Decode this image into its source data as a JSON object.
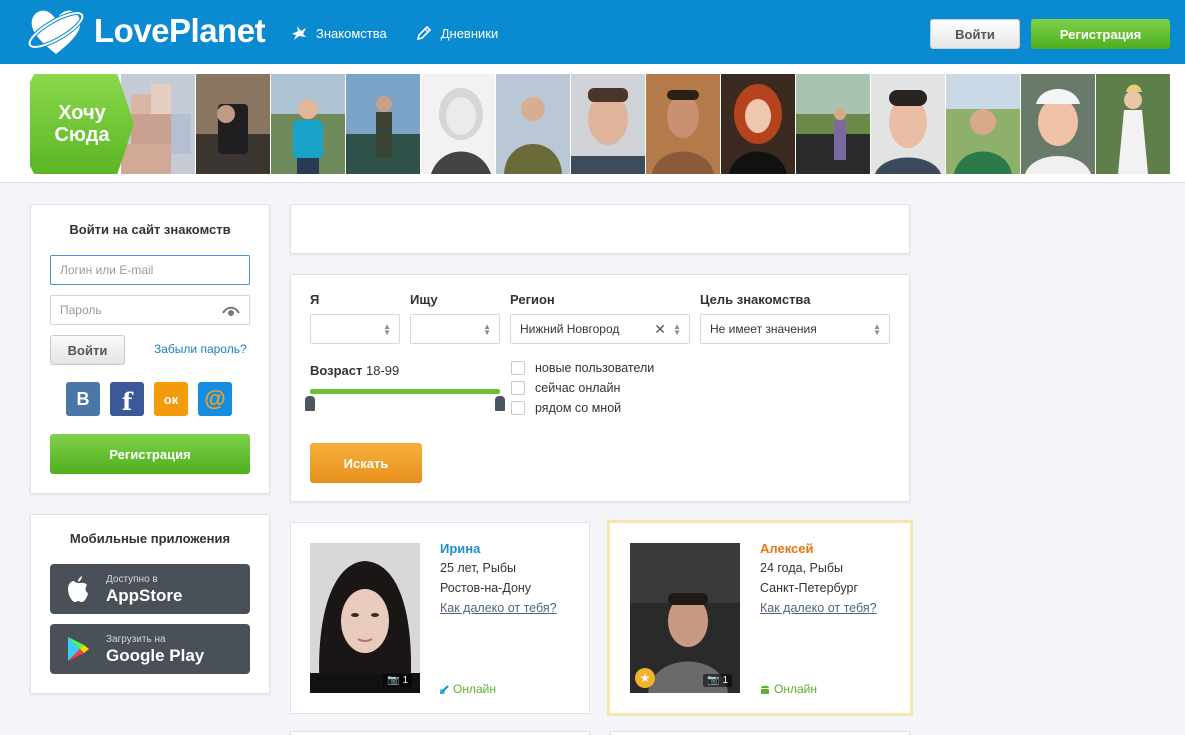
{
  "header": {
    "logo_text": "LovePlanet",
    "nav": [
      {
        "label": "Знакомства",
        "icon": "bird-icon"
      },
      {
        "label": "Дневники",
        "icon": "pencil-icon"
      }
    ],
    "login_label": "Войти",
    "register_label": "Регистрация"
  },
  "strip": {
    "cta_label": "Хочу Сюда"
  },
  "login": {
    "title": "Войти на сайт знакомств",
    "login_placeholder": "Логин или E-mail",
    "password_placeholder": "Пароль",
    "submit_label": "Войти",
    "forgot_label": "Забыли пароль?",
    "socials": [
      {
        "name": "vk-icon",
        "glyph": "В",
        "color": "#4a76a8"
      },
      {
        "name": "facebook-icon",
        "glyph": "f",
        "color": "#3b5998"
      },
      {
        "name": "odnoklassniki-icon",
        "glyph": "ок",
        "color": "#f29b0b"
      },
      {
        "name": "mailru-icon",
        "glyph": "@",
        "color": "#168de2"
      }
    ],
    "register_label": "Регистрация"
  },
  "apps": {
    "title": "Мобильные приложения",
    "appstore_small": "Доступно в",
    "appstore_big": "AppStore",
    "googleplay_small": "Загрузить на",
    "googleplay_big": "Google Play"
  },
  "search": {
    "i_label": "Я",
    "seek_label": "Ищу",
    "region_label": "Регион",
    "region_value": "Нижний Новгород",
    "goal_label": "Цель знакомства",
    "goal_value": "Не имеет значения",
    "age_label": "Возраст",
    "age_value": "18-99",
    "checkboxes": [
      "новые пользователи",
      "сейчас онлайн",
      "рядом со мной"
    ],
    "submit_label": "Искать"
  },
  "profiles": [
    {
      "name": "Ирина",
      "name_color": "#1a8fd0",
      "age_sign": "25 лет, Рыбы",
      "city": "Ростов-на-Дону",
      "distance_link": "Как далеко от тебя?",
      "photos": "1",
      "status": "Онлайн",
      "device_icon": "link-icon"
    },
    {
      "name": "Алексей",
      "name_color": "#e8770f",
      "age_sign": "24 года, Рыбы",
      "city": "Санкт-Петербург",
      "distance_link": "Как далеко от тебя?",
      "photos": "1",
      "status": "Онлайн",
      "device_icon": "android-icon"
    }
  ]
}
